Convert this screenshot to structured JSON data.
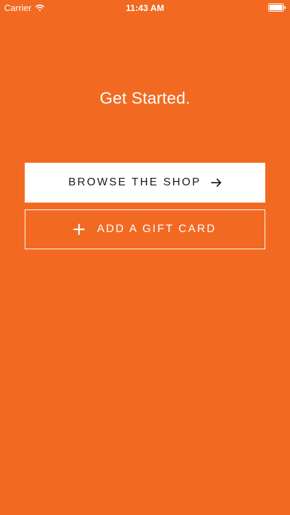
{
  "status_bar": {
    "carrier": "Carrier",
    "time": "11:43 AM",
    "wifi_icon": "wifi-icon",
    "battery_icon": "battery-icon"
  },
  "main": {
    "heading": "Get Started.",
    "browse_button": {
      "label": "BROWSE THE SHOP",
      "icon": "arrow-right-icon"
    },
    "gift_button": {
      "label": "ADD A GIFT CARD",
      "icon": "plus-icon"
    }
  },
  "colors": {
    "background": "#F26A22",
    "primary_button_bg": "#FFFFFF",
    "primary_button_text": "#1A1A1A",
    "secondary_button_border": "#FFFFFF",
    "text": "#FFFFFF"
  }
}
